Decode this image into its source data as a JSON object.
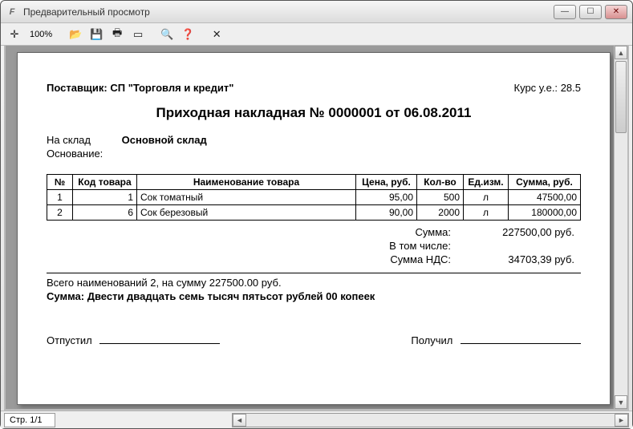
{
  "window": {
    "title": "Предварительный просмотр",
    "app_icon": "F"
  },
  "toolbar": {
    "zoom": "100%"
  },
  "status": {
    "page_indicator": "Стр. 1/1"
  },
  "doc": {
    "supplier_label": "Поставщик:",
    "supplier_name": "СП \"Торговля и кредит\"",
    "rate_label": "Курс у.е.:",
    "rate_value": "28.5",
    "title": "Приходная накладная № 0000001 от 06.08.2011",
    "to_store_label": "На склад",
    "to_store_value": "Основной склад",
    "basis_label": "Основание:",
    "basis_value": "",
    "columns": {
      "num": "№",
      "code": "Код товара",
      "name": "Наименование товара",
      "price": "Цена, руб.",
      "qty": "Кол-во",
      "unit": "Ед.изм.",
      "sum": "Сумма, руб."
    },
    "rows": [
      {
        "num": "1",
        "code": "1",
        "name": "Сок томатный",
        "price": "95,00",
        "qty": "500",
        "unit": "л",
        "sum": "47500,00"
      },
      {
        "num": "2",
        "code": "6",
        "name": "Сок березовый",
        "price": "90,00",
        "qty": "2000",
        "unit": "л",
        "sum": "180000,00"
      }
    ],
    "totals": {
      "sum_label": "Сумма:",
      "sum_value": "227500,00 руб.",
      "incl_label": "В том числе:",
      "vat_label": "Сумма НДС:",
      "vat_value": "34703,39 руб."
    },
    "summary_count": "Всего наименований 2, на сумму 227500.00 руб.",
    "summary_words_label": "Сумма:",
    "summary_words": "Двести двадцать семь тысяч пятьсот рублей 00 копеек",
    "released_label": "Отпустил",
    "received_label": "Получил"
  }
}
